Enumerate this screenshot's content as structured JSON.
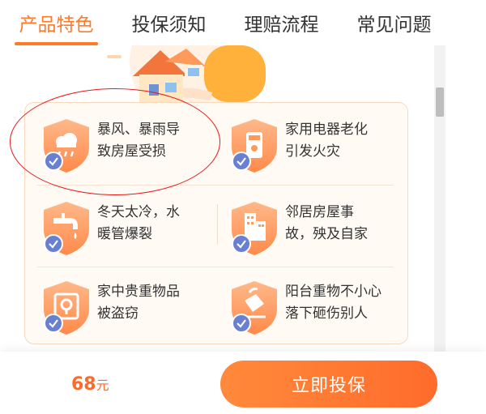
{
  "tabs": [
    {
      "label": "产品特色",
      "active": true
    },
    {
      "label": "投保须知",
      "active": false
    },
    {
      "label": "理赔流程",
      "active": false
    },
    {
      "label": "常见问题",
      "active": false
    }
  ],
  "features": [
    {
      "text": "暴风、暴雨导致房屋受损",
      "line1": "暴风、暴雨导",
      "line2": "致房屋受损",
      "icon": "rain-cloud-icon",
      "highlighted": true
    },
    {
      "text": "家用电器老化引发火灾",
      "line1": "家用电器老化",
      "line2": "引发火灾",
      "icon": "appliance-icon",
      "highlighted": false
    },
    {
      "text": "冬天太冷，水暖管爆裂",
      "line1": "冬天太冷，水",
      "line2": "暖管爆裂",
      "icon": "faucet-icon",
      "highlighted": false
    },
    {
      "text": "邻居房屋事故，殃及自家",
      "line1": "邻居房屋事",
      "line2": "故，殃及自家",
      "icon": "building-icon",
      "highlighted": false
    },
    {
      "text": "家中贵重物品被盗窃",
      "line1": "家中贵重物品",
      "line2": "被盗窃",
      "icon": "safe-icon",
      "highlighted": false
    },
    {
      "text": "阳台重物不小心落下砸伤别人",
      "line1": "阳台重物不小心",
      "line2": "落下砸伤别人",
      "icon": "falling-object-icon",
      "highlighted": false
    }
  ],
  "bottom": {
    "price": "68",
    "price_unit": "元",
    "buy_label": "立即投保"
  },
  "colors": {
    "accent": "#ff7a29",
    "check_badge": "#6b7fd0",
    "highlight": "#e81818",
    "card_border": "#f8d9bd"
  }
}
